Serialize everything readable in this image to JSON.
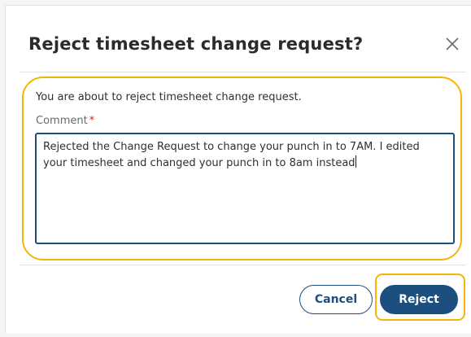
{
  "dialog": {
    "title": "Reject timesheet change request?",
    "close_icon": "close-icon",
    "intro": "You are about to reject timesheet change request.",
    "comment_label": "Comment",
    "required_marker": "*",
    "comment_value": "Rejected the Change Request to change your punch in to 7AM. I edited your timesheet and changed your punch in to 8am instead"
  },
  "buttons": {
    "cancel_label": "Cancel",
    "reject_label": "Reject"
  },
  "colors": {
    "primary": "#1c4e80",
    "highlight": "#f2b705",
    "required": "#d0271d"
  }
}
